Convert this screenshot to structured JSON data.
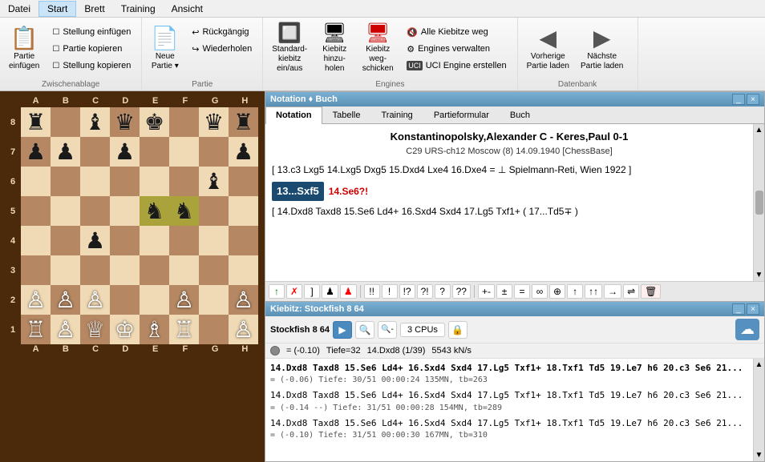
{
  "menu": {
    "items": [
      "Datei",
      "Start",
      "Brett",
      "Training",
      "Ansicht"
    ]
  },
  "ribbon": {
    "groups": [
      {
        "label": "Zwischenablage",
        "buttons": [
          {
            "label": "Partie\neinfügen",
            "icon": "📋"
          },
          {
            "label": "Stellung einfügen",
            "small": true
          },
          {
            "label": "Partie kopieren",
            "small": true
          },
          {
            "label": "Stellung kopieren",
            "small": true
          }
        ]
      },
      {
        "label": "Partie",
        "buttons": [
          {
            "label": "Neue\nPartie",
            "icon": "📄"
          },
          {
            "label": "Rückgängig",
            "small": true
          },
          {
            "label": "Wiederholen",
            "small": true
          }
        ]
      },
      {
        "label": "Engines",
        "buttons": [
          {
            "label": "Standard-\nkiebitz\nein/aus",
            "icon": "🔲"
          },
          {
            "label": "Kiebitz\nhinzu-\nholen",
            "icon": "🔲"
          },
          {
            "label": "Kiebitz\nweg-\nschicken",
            "icon": "🔲"
          },
          {
            "label": "Alle Kiebitze weg",
            "small": true
          },
          {
            "label": "Engines verwalten",
            "small": true
          },
          {
            "label": "UCI Engine erstellen",
            "small": true
          }
        ]
      },
      {
        "label": "Datenbank",
        "buttons": [
          {
            "label": "Vorherige\nPartie laden",
            "icon": "◀"
          },
          {
            "label": "Nächste\nPartie laden",
            "icon": "▶"
          }
        ]
      }
    ]
  },
  "notation_panel": {
    "title": "Notation ♦ Buch",
    "tabs": [
      "Notation",
      "Tabelle",
      "Training",
      "Partieformular",
      "Buch"
    ],
    "active_tab": "Notation",
    "game_title": "Konstantinopolsky,Alexander C - Keres,Paul  0-1",
    "game_subtitle": "C29  URS-ch12 Moscow (8) 14.09.1940 [ChessBase]",
    "variation_line": "[ 13.c3  Lxg5  14.Lxg5  Dxg5  15.Dxd4  Lxe4  16.Dxe4 = ⊥ Spielmann-Reti, Wien 1922 ]",
    "current_move_display": "13...Sxf5",
    "key_annotation": "14.Se6?!",
    "main_line": "[ 14.Dxd8  Taxd8  15.Se6  Ld4+  16.Sxd4  Sxd4  17.Lg5  Txf1+  ( 17...Td5∓ )"
  },
  "annotation_toolbar": {
    "buttons": [
      "↑",
      "✗",
      "]",
      "♟",
      "♟",
      "!!",
      "!",
      "!?",
      "?!",
      "?",
      "??",
      "+-",
      "±",
      "=",
      "∞",
      "⊕",
      "↑",
      "↑↑",
      "→+",
      "⇌",
      "🗑"
    ]
  },
  "kiebitz_panel": {
    "title": "Kiebitz: Stockfish 8 64",
    "engine_name": "Stockfish 8 64",
    "buttons": [
      "3 CPUs"
    ],
    "status": "= (-0.10)",
    "depth": "Tiefe=32",
    "move": "14.Dxd8 (1/39)",
    "speed": "5543 kN/s",
    "lines": [
      {
        "main": "14.Dxd8 Taxd8 15.Se6 Ld4+ 16.Sxd4 Sxd4 17.Lg5 Txf1+ 18.Txf1 Td5 19.Le7 h6 20.c3 Se6 21...",
        "secondary": "= (-0.06)  Tiefe: 30/51  00:00:24  135MN, tb=263",
        "bold": true
      },
      {
        "main": "14.Dxd8 Taxd8 15.Se6 Ld4+ 16.Sxd4 Sxd4 17.Lg5 Txf1+ 18.Txf1 Td5 19.Le7 h6 20.c3 Se6 21...",
        "secondary": "= (-0.14 --)  Tiefe: 31/51  00:00:28  154MN, tb=289",
        "bold": false
      },
      {
        "main": "14.Dxd8 Taxd8 15.Se6 Ld4+ 16.Sxd4 Sxd4 17.Lg5 Txf1+ 18.Txf1 Td5 19.Le7 h6 20.c3 Se6 21...",
        "secondary": "= (-0.10)  Tiefe: 31/51  00:00:30  167MN, tb=310",
        "bold": false
      }
    ]
  },
  "board": {
    "col_labels": [
      "A",
      "B",
      "C",
      "D",
      "E",
      "F",
      "G",
      "H"
    ],
    "row_labels": [
      "8",
      "7",
      "6",
      "5",
      "4",
      "3",
      "2",
      "1"
    ],
    "pieces": {
      "a8": {
        "piece": "♜",
        "color": "black"
      },
      "c8": {
        "piece": "♝",
        "color": "black"
      },
      "e8": {
        "piece": "♚",
        "color": "black"
      },
      "g8": {
        "piece": "♛",
        "color": "black"
      },
      "h8": {
        "piece": "♜",
        "color": "black"
      },
      "a7": {
        "piece": "♟",
        "color": "black"
      },
      "b7": {
        "piece": "♟",
        "color": "black"
      },
      "d7": {
        "piece": "♟",
        "color": "black"
      },
      "h7": {
        "piece": "♟",
        "color": "black"
      },
      "g6": {
        "piece": "♝",
        "color": "black"
      },
      "e5": {
        "piece": "♞",
        "color": "black"
      },
      "f5": {
        "piece": "♞",
        "color": "black"
      },
      "c4": {
        "piece": "♟",
        "color": "black"
      },
      "a2": {
        "piece": "♙",
        "color": "white"
      },
      "b2": {
        "piece": "♙",
        "color": "white"
      },
      "c2": {
        "piece": "♙",
        "color": "white"
      },
      "f2": {
        "piece": "♙",
        "color": "white"
      },
      "h2": {
        "piece": "♙",
        "color": "white"
      },
      "a1": {
        "piece": "♖",
        "color": "white"
      },
      "b1": {
        "piece": "♙",
        "color": "white"
      },
      "c1": {
        "piece": "♕",
        "color": "white"
      },
      "d1": {
        "piece": "♔",
        "color": "white"
      },
      "e1": {
        "piece": "♗",
        "color": "white"
      },
      "f1": {
        "piece": "♖",
        "color": "white"
      },
      "h1": {
        "piece": "♙",
        "color": "white"
      },
      "d8": {
        "piece": "♛",
        "color": "black"
      }
    },
    "highlight_squares": [
      "e5",
      "f5"
    ]
  }
}
